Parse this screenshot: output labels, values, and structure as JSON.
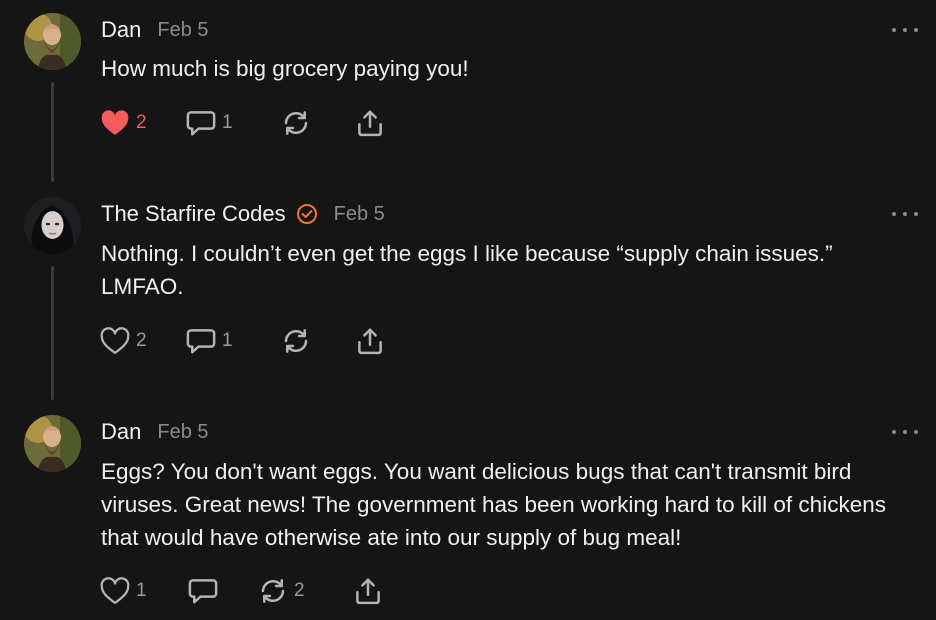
{
  "posts": [
    {
      "author": "Dan",
      "date": "Feb 5",
      "text": "How much is big grocery paying you!",
      "likes": "2",
      "liked": true,
      "comments": "1",
      "restacks": ""
    },
    {
      "author": "The Starfire Codes",
      "verified": true,
      "date": "Feb 5",
      "text": "Nothing. I couldn’t even get the eggs I like because “supply chain issues.” LMFAO.",
      "likes": "2",
      "liked": false,
      "comments": "1",
      "restacks": ""
    },
    {
      "author": "Dan",
      "date": "Feb 5",
      "text": "Eggs? You don't want eggs. You want delicious bugs that can't transmit bird viruses. Great news! The government has been working hard to kill of chickens that would have otherwise ate into our supply of bug meal!",
      "likes": "1",
      "liked": false,
      "comments": "",
      "restacks": "2"
    }
  ],
  "icons": {
    "like": "heart-icon",
    "comment": "speech-bubble-icon",
    "restack": "restack-arrows-icon",
    "share": "share-upload-icon",
    "more": "ellipsis-icon",
    "verified": "verified-check-icon"
  },
  "colors": {
    "background": "#151516",
    "liked": "#f45b5b",
    "verified": "#f0762e",
    "muted": "#8a8a8e"
  }
}
